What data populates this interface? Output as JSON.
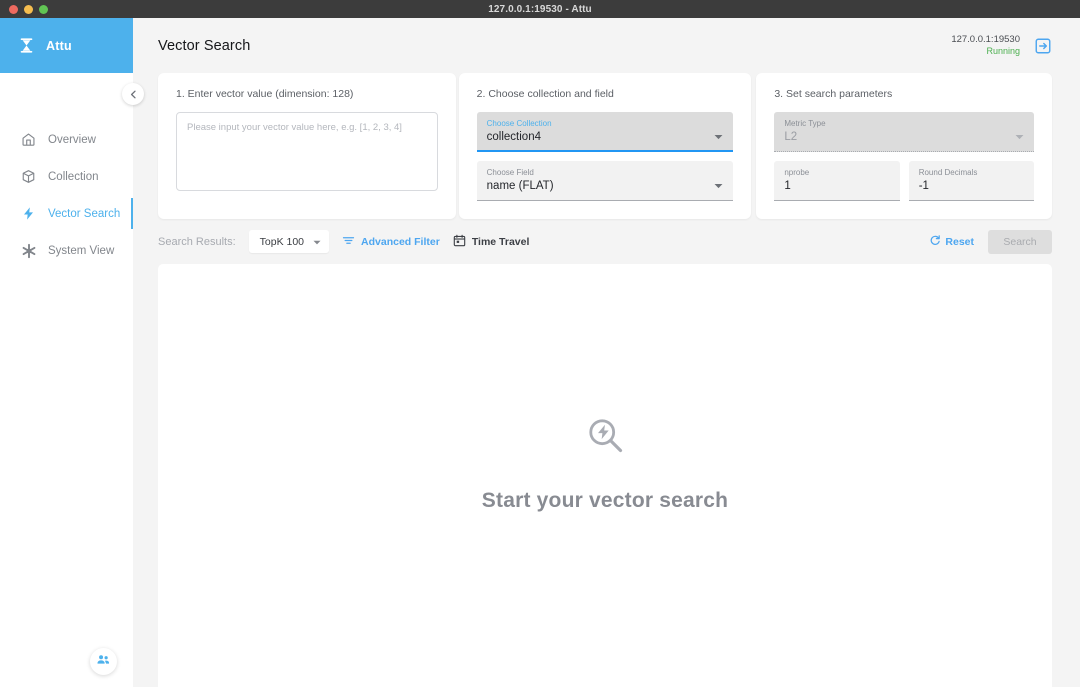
{
  "window": {
    "title": "127.0.0.1:19530 - Attu",
    "traffic_lights": [
      "close",
      "minimize",
      "maximize"
    ]
  },
  "sidebar": {
    "brand": {
      "name": "Attu",
      "logo_icon": "attu-hourglass-icon"
    },
    "collapse_icon": "chevron-left-icon",
    "items": [
      {
        "label": "Overview",
        "icon": "home-icon",
        "active": false
      },
      {
        "label": "Collection",
        "icon": "box-icon",
        "active": false
      },
      {
        "label": "Vector Search",
        "icon": "lightning-bolt-icon",
        "active": true
      },
      {
        "label": "System View",
        "icon": "snowflake-icon",
        "active": false
      }
    ],
    "fab": {
      "icon": "people-group-icon"
    }
  },
  "header": {
    "title": "Vector Search",
    "status": {
      "address": "127.0.0.1:19530",
      "state": "Running",
      "logout_icon": "logout-icon"
    }
  },
  "cards": {
    "card1": {
      "title": "1. Enter vector value (dimension: 128)",
      "textarea_placeholder": "Please input your vector value here, e.g. [1, 2, 3, 4]",
      "textarea_value": ""
    },
    "card2": {
      "title": "2. Choose collection and field",
      "collection": {
        "label": "Choose Collection",
        "value": "collection4",
        "caret_icon": "caret-down-icon"
      },
      "field": {
        "label": "Choose Field",
        "value": "name (FLAT)",
        "caret_icon": "caret-down-icon"
      }
    },
    "card3": {
      "title": "3. Set search parameters",
      "metric": {
        "label": "Metric Type",
        "value": "L2",
        "caret_icon": "caret-down-icon"
      },
      "nprobe": {
        "label": "nprobe",
        "value": "1"
      },
      "round_decimals": {
        "label": "Round Decimals",
        "value": "-1"
      }
    }
  },
  "toolbar": {
    "results_label": "Search Results:",
    "topk": {
      "value": "TopK 100",
      "caret_icon": "caret-down-icon"
    },
    "advanced_filter": {
      "label": "Advanced Filter",
      "icon": "filter-icon"
    },
    "time_travel": {
      "label": "Time Travel",
      "icon": "calendar-icon"
    },
    "reset": {
      "label": "Reset",
      "icon": "refresh-icon"
    },
    "search": {
      "label": "Search",
      "disabled": true
    }
  },
  "results": {
    "empty_icon": "vector-search-icon",
    "empty_text": "Start your vector search"
  },
  "colors": {
    "brand_blue": "#4db1ec",
    "accent_blue": "#4da6f0",
    "focus_blue": "#2196f3",
    "running_green": "#4caf50",
    "page_bg": "#f4f4f4",
    "titlebar": "#3c3c3c",
    "muted_text": "#888b92"
  }
}
